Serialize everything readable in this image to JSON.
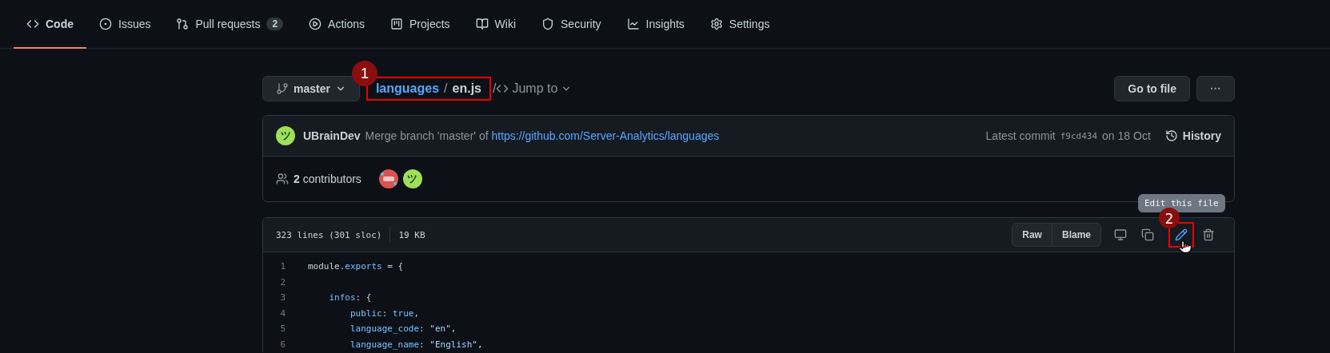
{
  "repo_nav": [
    {
      "label": "Code",
      "selected": true
    },
    {
      "label": "Issues",
      "selected": false
    },
    {
      "label": "Pull requests",
      "count": "2",
      "selected": false
    },
    {
      "label": "Actions",
      "selected": false
    },
    {
      "label": "Projects",
      "selected": false
    },
    {
      "label": "Wiki",
      "selected": false
    },
    {
      "label": "Security",
      "selected": false
    },
    {
      "label": "Insights",
      "selected": false
    },
    {
      "label": "Settings",
      "selected": false
    }
  ],
  "file_bar": {
    "branch": "master",
    "breadcrumb": {
      "folder": "languages",
      "separator": "/",
      "file": "en.js",
      "annotation": "1"
    },
    "trail_separator": "/",
    "jump_to": "Jump to",
    "go_to_file": "Go to file",
    "more": "···"
  },
  "commit": {
    "avatar_glyph": "ツ",
    "author": "UBrainDev",
    "message": "Merge branch 'master' of ",
    "link": "https://github.com/Server-Analytics/languages",
    "latest_label": "Latest commit",
    "sha": "f9cd434",
    "date": "on 18 Oct",
    "history": "History"
  },
  "contributors": {
    "count": "2",
    "label": "contributors",
    "avatars": [
      {
        "kind": "logo"
      },
      {
        "kind": "glyph",
        "glyph": "ツ"
      }
    ]
  },
  "file": {
    "lines": "323 lines (301 sloc)",
    "size": "19 KB",
    "raw": "Raw",
    "blame": "Blame",
    "edit_tooltip": "Edit this file",
    "edit_annotation": "2",
    "code": [
      {
        "number": "1",
        "tokens": [
          {
            "text": "module.",
            "kind": "plain"
          },
          {
            "text": "exports",
            "kind": "prop"
          },
          {
            "text": " = {",
            "kind": "plain"
          }
        ]
      },
      {
        "number": "2"
      },
      {
        "number": "3",
        "tokens": [
          {
            "text": "    infos",
            "kind": "prop"
          },
          {
            "text": ": {",
            "kind": "plain"
          }
        ]
      },
      {
        "number": "4",
        "tokens": [
          {
            "text": "        public",
            "kind": "prop"
          },
          {
            "text": ": ",
            "kind": "plain"
          },
          {
            "text": "true",
            "kind": "keyword"
          },
          {
            "text": ",",
            "kind": "plain"
          }
        ]
      },
      {
        "number": "5",
        "tokens": [
          {
            "text": "        language_code",
            "kind": "prop"
          },
          {
            "text": ": ",
            "kind": "plain"
          },
          {
            "text": "\"en\"",
            "kind": "string"
          },
          {
            "text": ",",
            "kind": "plain"
          }
        ]
      },
      {
        "number": "6",
        "tokens": [
          {
            "text": "        language_name",
            "kind": "prop"
          },
          {
            "text": ": ",
            "kind": "plain"
          },
          {
            "text": "\"English\"",
            "kind": "string"
          },
          {
            "text": ",",
            "kind": "plain"
          }
        ]
      }
    ]
  }
}
